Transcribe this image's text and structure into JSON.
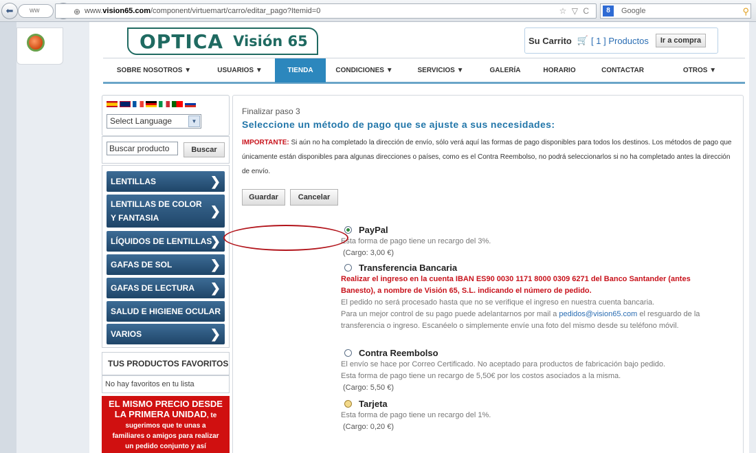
{
  "browser": {
    "history_label": "ww",
    "url_prefix": "www.",
    "url_domain": "vision65.com",
    "url_path": "/component/virtuemart/carro/editar_pago?Itemid=0",
    "url_right_icons": "☆ ▽ C",
    "search_placeholder": "Google",
    "search_badge": "8"
  },
  "header": {
    "logo_main": "OPTICA",
    "logo_sub": "Visión 65",
    "cart_title": "Su Carrito",
    "cart_count_text": "[ 1 ] Productos",
    "cart_button": "Ir a compra"
  },
  "menu": [
    {
      "label": "SOBRE NOSOTROS ▼",
      "active": false
    },
    {
      "label": "USUARIOS ▼",
      "active": false
    },
    {
      "label": "TIENDA",
      "active": true
    },
    {
      "label": "CONDICIONES ▼",
      "active": false
    },
    {
      "label": "SERVICIOS ▼",
      "active": false
    },
    {
      "label": "GALERÍA",
      "active": false
    },
    {
      "label": "HORARIO",
      "active": false
    },
    {
      "label": "CONTACTAR",
      "active": false
    },
    {
      "label": "OTROS ▼",
      "active": false
    }
  ],
  "sidebar": {
    "language_select": "Select Language",
    "search_value": "Buscar producto",
    "search_button": "Buscar",
    "categories": [
      {
        "label": "LENTILLAS"
      },
      {
        "label": "LENTILLAS DE COLOR Y FANTASIA"
      },
      {
        "label": "LÍQUIDOS DE LENTILLAS"
      },
      {
        "label": "GAFAS DE SOL"
      },
      {
        "label": "GAFAS DE LECTURA"
      },
      {
        "label": "SALUD E HIGIENE OCULAR"
      },
      {
        "label": "VARIOS"
      }
    ],
    "favorites_title": "TUS PRODUCTOS FAVORITOS",
    "favorites_empty": "No hay favoritos en tu lista",
    "promo_line1": "EL MISMO PRECIO DESDE",
    "promo_line2a": "LA PRIMERA UNIDAD",
    "promo_line2b": ", te",
    "promo_line3": "sugerimos que te unas a",
    "promo_line4": "familiares o amigos para realizar",
    "promo_line5": "un pedido conjunto y así"
  },
  "main": {
    "step": "Finalizar paso 3",
    "heading": "Seleccione un método de pago que se ajuste a sus necesidades:",
    "notice_label": "IMPORTANTE:",
    "notice_text": " Si aún no ha completado la dirección de envío, sólo verá aquí las formas de pago disponibles para todos los destinos. Los métodos de pago que únicamente están disponibles para algunas direcciones o países, como es el Contra Reembolso, no podrá seleccionarlos si no ha completado antes la dirección de envío.",
    "save_button": "Guardar",
    "cancel_button": "Cancelar",
    "payments": {
      "paypal": {
        "name": "PayPal",
        "selected": true,
        "desc": "Esta forma de pago tiene un recargo del 3%.",
        "cost": "(Cargo: 3,00 €)"
      },
      "transfer": {
        "name": "Transferencia Bancaria",
        "selected": false,
        "red1": "Realizar el ingreso en la cuenta IBAN ES90 0030 1171 8000 0309 6271 del Banco Santander (antes",
        "red2": "Banesto), a nombre de Visión 65, S.L. indicando el número de pedido.",
        "desc1": "El pedido no será procesado hasta que no se verifique el ingreso en nuestra cuenta bancaria.",
        "desc2a": "Para un mejor control de su pago puede adelantarnos por mail a ",
        "email": "pedidos@vision65.com",
        "desc2b": " el resguardo de la",
        "desc3": "transferencia o ingreso. Escanéelo o simplemente envíe una foto del mismo desde su teléfono móvil."
      },
      "cod": {
        "name": "Contra Reembolso",
        "selected": false,
        "desc1": "El envío se hace por Correo Certificado.  No aceptado para productos de fabricación bajo pedido.",
        "desc2": "Esta forma de pago tiene un recargo de 5,50€ por los costos asociados a la misma.",
        "cost": "(Cargo: 5,50 €)"
      },
      "card": {
        "name": "Tarjeta",
        "selected": false,
        "desc": "Esta forma de pago tiene un recargo del 1%.",
        "cost": "(Cargo: 0,20 €)"
      }
    }
  },
  "colors": {
    "accent_blue": "#2c87bd",
    "heading_blue": "#2276a9",
    "warning_red": "#c8121b",
    "logo_green": "#1f6a61",
    "annotation_red": "#b2141b"
  }
}
